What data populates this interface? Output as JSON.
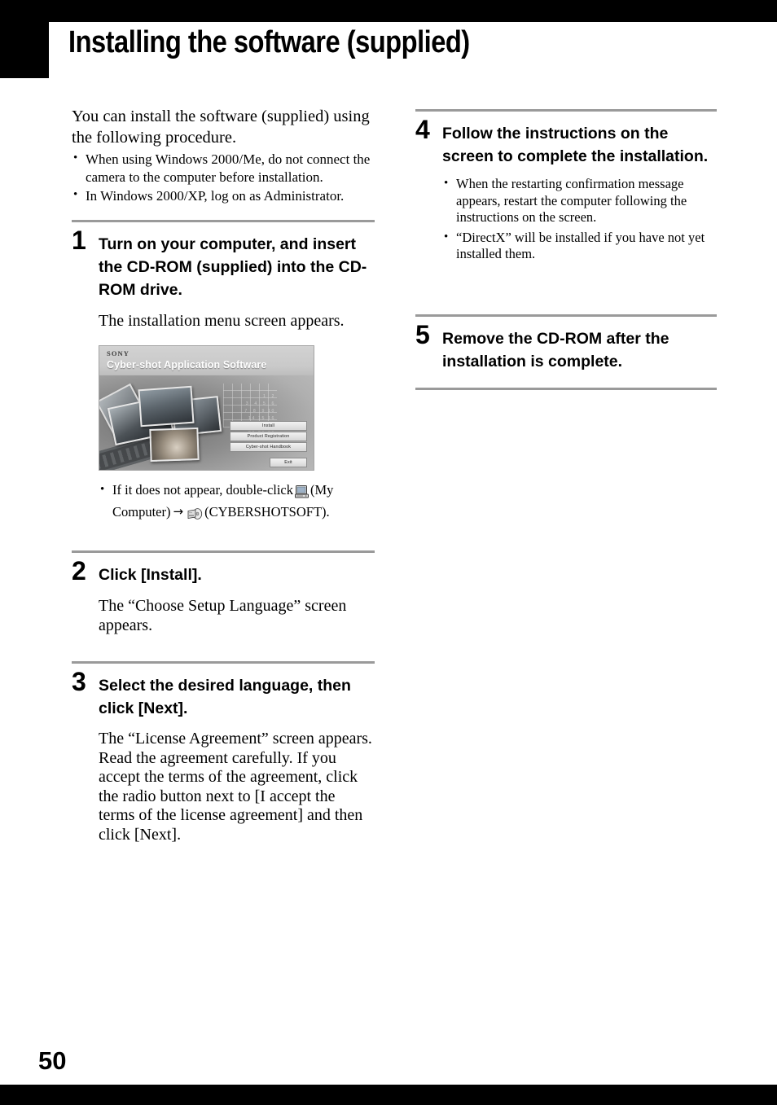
{
  "page": {
    "title": "Installing the software (supplied)",
    "number": "50"
  },
  "intro": {
    "lead": "You can install the software (supplied) using the following procedure.",
    "notes": [
      "When using Windows 2000/Me, do not connect the camera to the computer before installation.",
      "In Windows 2000/XP, log on as Administrator."
    ]
  },
  "steps": {
    "step1": {
      "number": "1",
      "heading": "Turn on your computer, and insert the CD-ROM (supplied) into the CD-ROM drive.",
      "text": "The installation menu screen appears.",
      "note_pre": "If it does not appear, double-click",
      "note_mid": "(My Computer)",
      "note_post": "(CYBERSHOTSOFT).",
      "arrow": "→",
      "icons": {
        "my_computer": "my-computer-icon",
        "cd_drive": "cd-drive-icon"
      }
    },
    "step2": {
      "number": "2",
      "heading": "Click [Install].",
      "text": "The “Choose Setup Language” screen appears."
    },
    "step3": {
      "number": "3",
      "heading": "Select the desired language, then click [Next].",
      "text": "The “License Agreement” screen appears.\nRead the agreement carefully. If you accept the terms of the agreement, click the radio button next to [I accept the terms of the license agreement] and then click [Next]."
    },
    "step4": {
      "number": "4",
      "heading": "Follow the instructions on the screen to complete the installation.",
      "notes": [
        "When the restarting confirmation message appears, restart the computer following the instructions on the screen.",
        "“DirectX” will be installed if you have not yet installed them."
      ]
    },
    "step5": {
      "number": "5",
      "heading": "Remove the CD-ROM after the installation is complete."
    }
  },
  "installer_screenshot": {
    "brand": "SONY",
    "app_title": "Cyber-shot Application Software",
    "buttons": [
      "Install",
      "Product Registration",
      "Cyber-shot Handbook",
      "Exit"
    ],
    "calendar_digits": "1  2\n3  4  5  6\n7  8  9 10\n14 15 16\n21 22 23\n28 29 30"
  },
  "colors": {
    "rule": "#9a9a9a",
    "bar": "#000000",
    "text": "#000000"
  }
}
